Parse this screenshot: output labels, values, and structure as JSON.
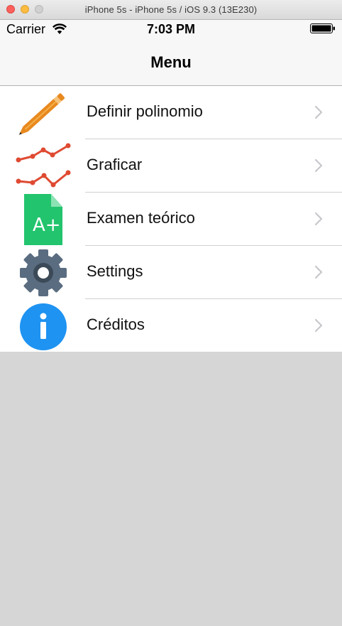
{
  "window": {
    "title": "iPhone 5s - iPhone 5s / iOS 9.3 (13E230)"
  },
  "status_bar": {
    "carrier": "Carrier",
    "time": "7:03 PM",
    "wifi_icon": "wifi-icon",
    "battery_icon": "battery-icon"
  },
  "nav": {
    "title": "Menu"
  },
  "menu": {
    "items": [
      {
        "label": "Definir polinomio",
        "icon": "pencil-icon",
        "accent": "#e8891f"
      },
      {
        "label": "Graficar",
        "icon": "line-chart-icon",
        "accent": "#df4a32"
      },
      {
        "label": "Examen teórico",
        "icon": "grade-document-icon",
        "accent": "#22c46e"
      },
      {
        "label": "Settings",
        "icon": "gear-icon",
        "accent": "#5a6c80"
      },
      {
        "label": "Créditos",
        "icon": "info-icon",
        "accent": "#1e93f2"
      }
    ]
  },
  "colors": {
    "background": "#d6d6d6",
    "nav_background": "#f7f7f7",
    "separator": "#d0d0d0",
    "chevron": "#c7c7cc"
  }
}
